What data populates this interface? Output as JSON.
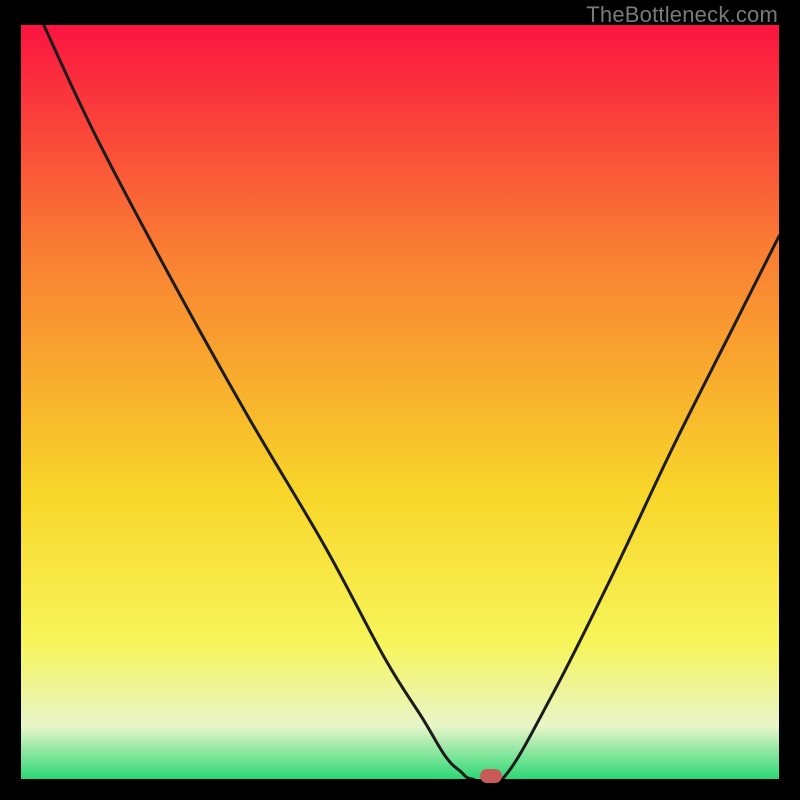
{
  "watermark": "TheBottleneck.com",
  "colors": {
    "gradient_top": "#fb1440",
    "gradient_upper_mid": "#f97e33",
    "gradient_mid": "#f8d629",
    "gradient_lower_mid": "#f7f55b",
    "gradient_pale": "#e8f5c9",
    "gradient_bottom": "#2bd873",
    "curve_stroke": "#1c1c1c",
    "marker_fill": "#c85a5a",
    "frame_bg": "#000000"
  },
  "chart_data": {
    "type": "line",
    "title": "",
    "xlabel": "",
    "ylabel": "",
    "xlim": [
      0,
      100
    ],
    "ylim": [
      0,
      100
    ],
    "series": [
      {
        "name": "left-branch",
        "x": [
          3,
          10,
          20,
          30,
          40,
          48,
          53,
          56,
          58,
          59.5
        ],
        "y": [
          100,
          85,
          66,
          48,
          31,
          16,
          8,
          3,
          1,
          0
        ]
      },
      {
        "name": "flat-segment",
        "x": [
          59.5,
          63.5
        ],
        "y": [
          0,
          0
        ]
      },
      {
        "name": "right-branch",
        "x": [
          63.5,
          70,
          78,
          86,
          94,
          100
        ],
        "y": [
          0,
          11,
          27,
          44,
          60,
          72
        ]
      }
    ],
    "marker": {
      "x": 62,
      "y": 0
    },
    "gradient_stops": [
      {
        "offset": 0.0,
        "color_key": "gradient_top"
      },
      {
        "offset": 0.3,
        "color_key": "gradient_upper_mid"
      },
      {
        "offset": 0.62,
        "color_key": "gradient_mid"
      },
      {
        "offset": 0.82,
        "color_key": "gradient_lower_mid"
      },
      {
        "offset": 0.93,
        "color_key": "gradient_pale"
      },
      {
        "offset": 1.0,
        "color_key": "gradient_bottom"
      }
    ]
  }
}
